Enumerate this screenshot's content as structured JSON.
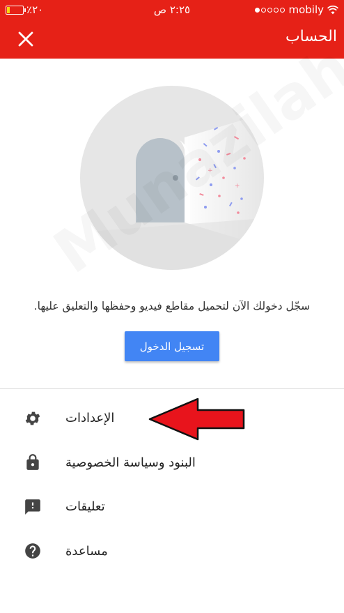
{
  "status_bar": {
    "carrier": "mobily",
    "time": "٢:٢٥ ص",
    "battery_percent": "٪٢٠",
    "battery_level": 0.2,
    "signal_bars": 1,
    "signal_total": 5
  },
  "app_bar": {
    "title": "الحساب",
    "close_icon": "close-icon"
  },
  "account": {
    "message": "سجّل دخولك الآن لتحميل مقاطع فيديو وحفظها والتعليق عليها.",
    "signin_label": "تسجيل الدخول"
  },
  "menu": {
    "items": [
      {
        "label": "الإعدادات",
        "icon": "gear-icon"
      },
      {
        "label": "البنود وسياسة الخصوصية",
        "icon": "lock-icon"
      },
      {
        "label": "تعليقات",
        "icon": "feedback-icon"
      },
      {
        "label": "مساعدة",
        "icon": "help-icon"
      }
    ]
  },
  "watermark": "Munazilah",
  "colors": {
    "brand_red": "#e62117",
    "button_blue": "#4285f4",
    "annotation_red": "#e8141c"
  }
}
